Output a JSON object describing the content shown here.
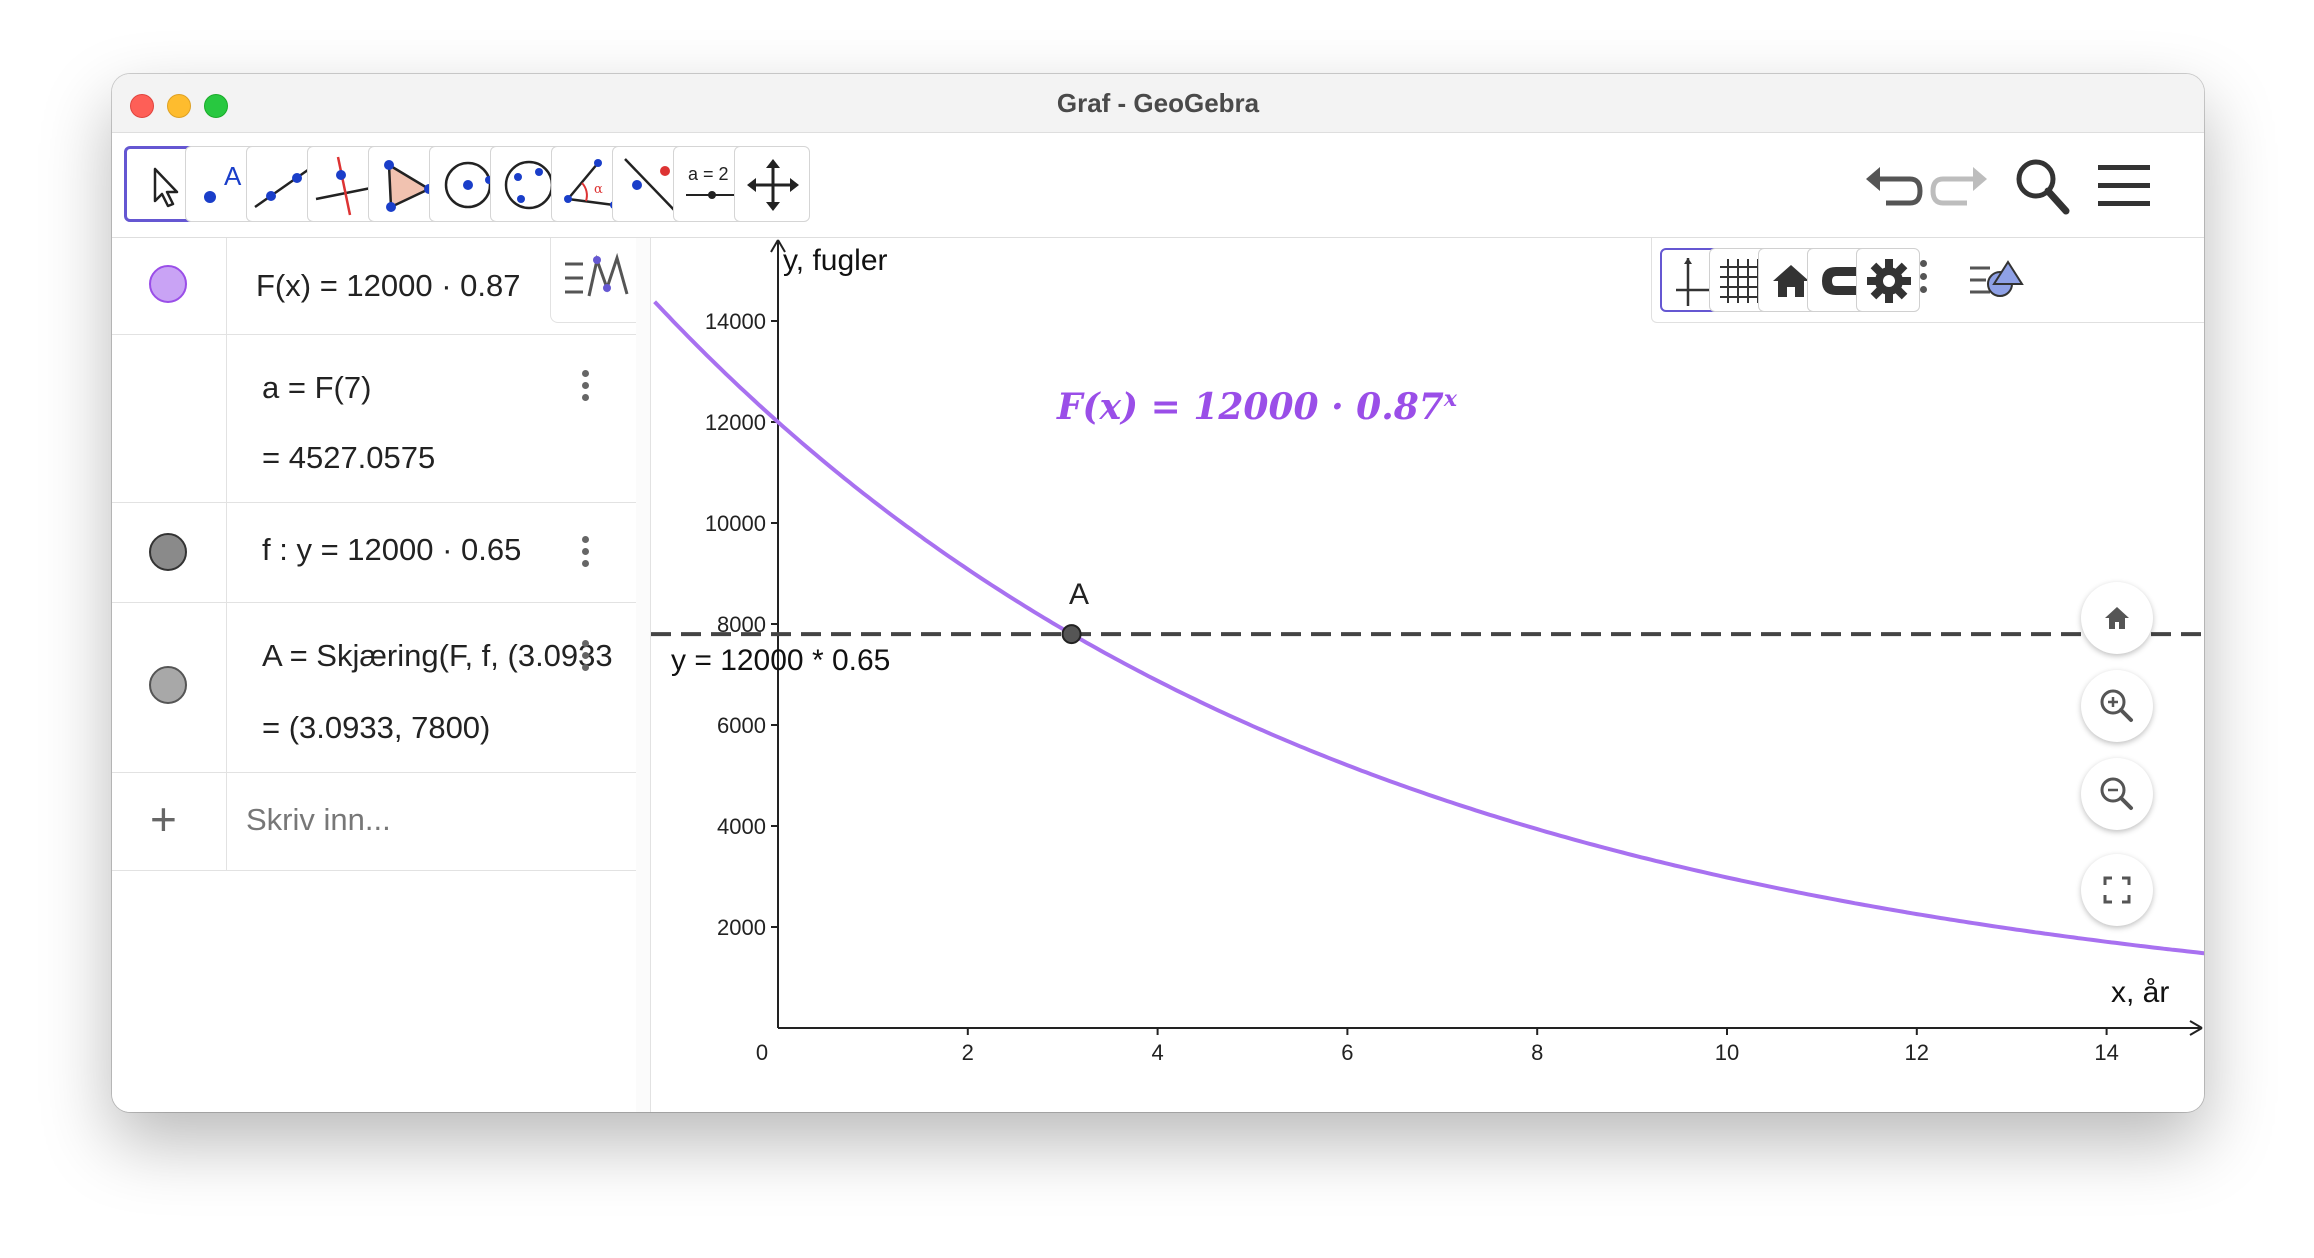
{
  "window": {
    "title": "Graf - GeoGebra"
  },
  "toolbar": {
    "tools": [
      {
        "name": "move-tool",
        "icon": "arrow-cursor-icon"
      },
      {
        "name": "point-tool",
        "icon": "point-icon",
        "label": "A"
      },
      {
        "name": "line-tool",
        "icon": "line-icon"
      },
      {
        "name": "perpendicular-line-tool",
        "icon": "perpendicular-icon"
      },
      {
        "name": "polygon-tool",
        "icon": "polygon-icon"
      },
      {
        "name": "circle-center-point-tool",
        "icon": "circle-icon"
      },
      {
        "name": "circle-three-points-tool",
        "icon": "circle-three-points-icon"
      },
      {
        "name": "angle-tool",
        "icon": "angle-icon",
        "label": "α"
      },
      {
        "name": "reflect-tool",
        "icon": "reflect-icon"
      },
      {
        "name": "slider-tool",
        "icon": "slider-icon",
        "label": "a = 2"
      },
      {
        "name": "move-graphics-tool",
        "icon": "move-arrows-icon"
      }
    ],
    "right": [
      "undo-icon",
      "redo-icon",
      "search-icon",
      "menu-icon"
    ]
  },
  "algebra": {
    "rows": [
      {
        "id": "F",
        "color": "#c9a3f5",
        "border": "#9a4ee8",
        "text": "F(x)  =  12000 · 0.87"
      },
      {
        "id": "a",
        "text": "a  =  F(7)",
        "value": "=    4527.0575"
      },
      {
        "id": "f",
        "color": "#8a8a8a",
        "border": "#333333",
        "text": "f :  y  =  12000 · 0.65"
      },
      {
        "id": "A",
        "color": "#a8a8a8",
        "border": "#555555",
        "text": "A  =  Skjæring(F, f, (3.0933",
        "value": "=    (3.0933, 7800)"
      }
    ],
    "input_placeholder": "Skriv inn..."
  },
  "graphics": {
    "function_label": "F(x)  =  12000 · 0.87",
    "function_exponent": "x",
    "line_label": "y = 12000 * 0.65",
    "point_label": "A",
    "y_axis_title": "y, fugler",
    "x_axis_title": "x, år",
    "origin_label": "0"
  },
  "chart_data": {
    "type": "line",
    "x_axis": {
      "label": "x, år",
      "ticks": [
        2,
        4,
        6,
        8,
        10,
        12,
        14
      ],
      "range": [
        0,
        15.2
      ]
    },
    "y_axis": {
      "label": "y, fugler",
      "ticks": [
        2000,
        4000,
        6000,
        8000,
        10000,
        12000,
        14000
      ],
      "range": [
        0,
        14900
      ]
    },
    "series": [
      {
        "name": "F(x) = 12000 · 0.87^x",
        "kind": "exponential",
        "a": 12000,
        "b": 0.87,
        "x_start": -1.3,
        "x_end": 15.2,
        "color": "#a871f0"
      },
      {
        "name": "y = 12000 * 0.65",
        "kind": "horizontal",
        "y": 7800,
        "style": "dashed",
        "color": "#444444"
      }
    ],
    "points": [
      {
        "name": "A",
        "x": 3.0933,
        "y": 7800
      }
    ],
    "grid": false
  }
}
